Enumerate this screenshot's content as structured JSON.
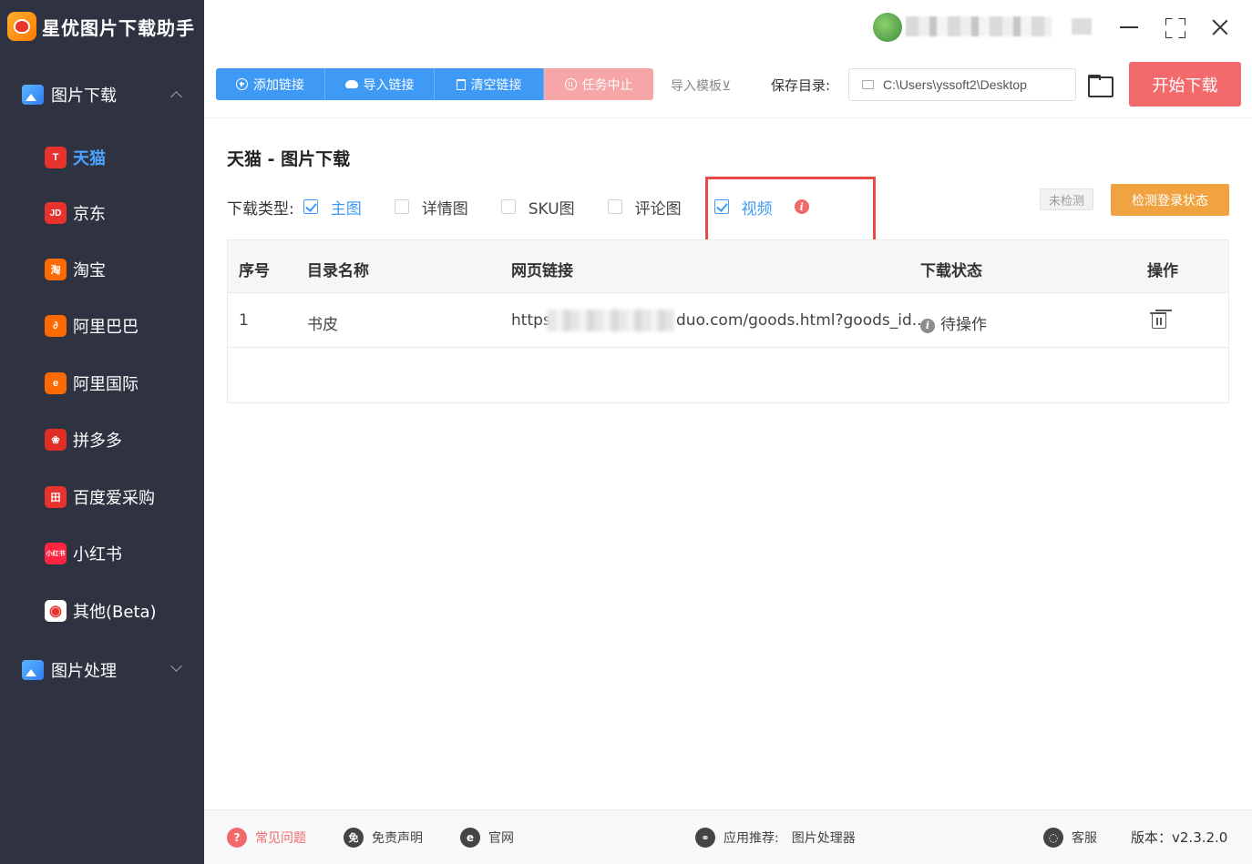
{
  "app": {
    "title": "星优图片下载助手"
  },
  "sidebar": {
    "groups": [
      {
        "label": "图片下载",
        "icon": "image-download-icon",
        "expanded": true
      },
      {
        "label": "图片处理",
        "icon": "image-process-icon",
        "expanded": false
      }
    ],
    "items": [
      {
        "label": "天猫",
        "icon_text": "T",
        "color": "#e8322d",
        "active": true
      },
      {
        "label": "京东",
        "icon_text": "JD",
        "color": "#e8322d"
      },
      {
        "label": "淘宝",
        "icon_text": "淘",
        "color": "#ff6a00"
      },
      {
        "label": "阿里巴巴",
        "icon_text": "∂",
        "color": "#ff6a00"
      },
      {
        "label": "阿里国际",
        "icon_text": "e",
        "color": "#ff6a00"
      },
      {
        "label": "拼多多",
        "icon_text": "❀",
        "color": "#e02e24"
      },
      {
        "label": "百度爱采购",
        "icon_text": "田",
        "color": "#e8322d"
      },
      {
        "label": "小红书",
        "icon_text": "小红书",
        "color": "#ff2442"
      },
      {
        "label": "其他(Beta)",
        "icon_text": "◉",
        "color": "#ffffff"
      }
    ]
  },
  "toolbar": {
    "add_link": "添加链接",
    "import_link": "导入链接",
    "clear_link": "清空链接",
    "stop_task": "任务中止",
    "import_template": "导入模板⊻",
    "save_dir_label": "保存目录:",
    "save_dir_value": "C:\\Users\\yssoft2\\Desktop",
    "start_download": "开始下载"
  },
  "main": {
    "title": "天猫 - 图片下载",
    "type_label": "下载类型:",
    "types": [
      {
        "label": "主图",
        "checked": true
      },
      {
        "label": "详情图",
        "checked": false
      },
      {
        "label": "SKU图",
        "checked": false
      },
      {
        "label": "评论图",
        "checked": false
      },
      {
        "label": "视频",
        "checked": true
      }
    ],
    "login_status": "未检测",
    "detect_login": "检测登录状态",
    "table": {
      "headers": [
        "序号",
        "目录名称",
        "网页链接",
        "下载状态",
        "操作"
      ],
      "rows": [
        {
          "index": "1",
          "dir": "书皮",
          "url_prefix": "https:",
          "url_suffix": "duo.com/goods.html?goods_id...",
          "status": "待操作"
        }
      ]
    }
  },
  "footer": {
    "faq": "常见问题",
    "disclaimer": "免责声明",
    "website": "官网",
    "recommend_label": "应用推荐:",
    "recommend_app": "图片处理器",
    "support": "客服",
    "version": "版本：v2.3.2.0"
  }
}
